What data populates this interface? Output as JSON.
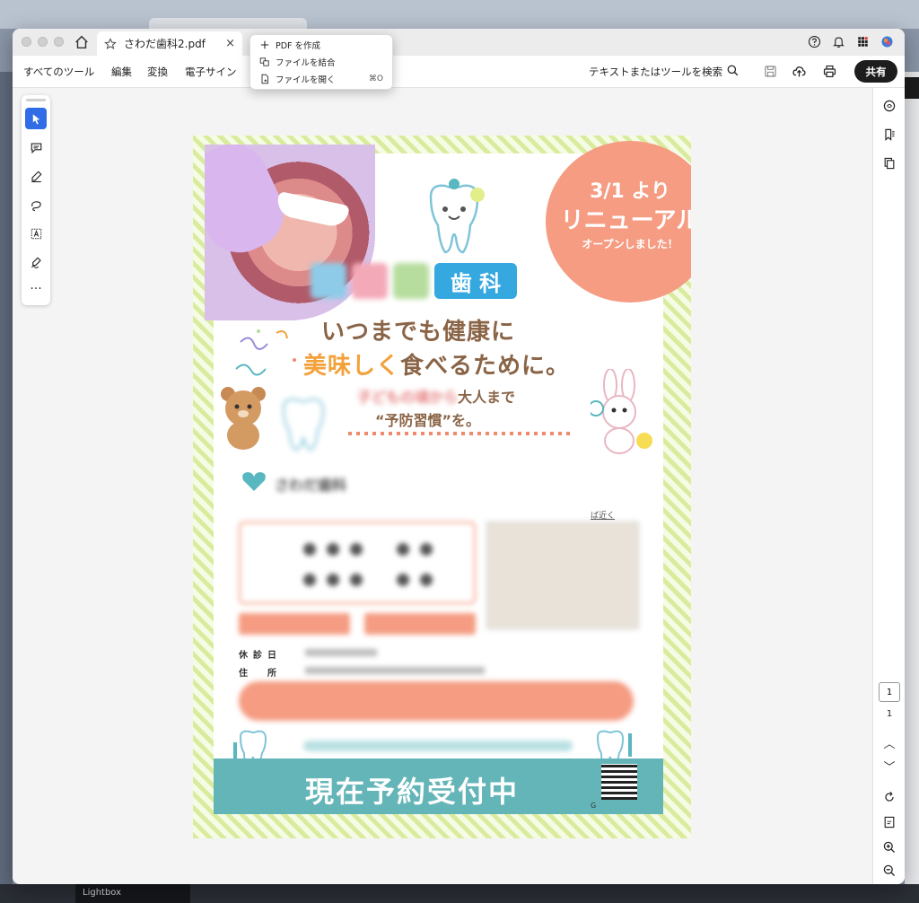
{
  "window": {
    "tab_title": "さわだ歯科2.pdf",
    "tab_close": "×"
  },
  "menubar": {
    "items": [
      "すべてのツール",
      "編集",
      "変換",
      "電子サイン"
    ],
    "search_label": "テキストまたはツールを検索",
    "share_label": "共有"
  },
  "dropdown": {
    "create_pdf": "PDF を作成",
    "combine_files": "ファイルを結合",
    "open_file": "ファイルを開く",
    "open_file_shortcut": "⌘O"
  },
  "right_panel": {
    "page_current": "1",
    "page_total": "1"
  },
  "background": {
    "lightbox_label": "Lightbox"
  },
  "document": {
    "badge_line1": "3/1 より",
    "badge_line2": "リニューアル",
    "badge_line3": "オープンしました！",
    "clinic_name_visible": "歯 科",
    "headline1": "いつまでも健康に",
    "headline2_highlight": "美味しく",
    "headline2_rest": "食べるために。",
    "sub1_start": "子どもの頃から",
    "sub1_rest": "大人まで",
    "sub2": "“予防習慣”を。",
    "info_clinic_name": "さわだ歯科",
    "map_link": "ば近く",
    "label_holiday": "休診日",
    "label_address": "住所",
    "reserve_text": "現在予約受付中",
    "qr_label": "G"
  },
  "colors": {
    "accent_blue": "#2f6ce5",
    "badge_salmon": "#f59c82",
    "stripe_green": "#d9ec9e",
    "reserve_teal": "#64b5b8",
    "headline_brown": "#8a6446",
    "headline_orange": "#f2a13b"
  }
}
